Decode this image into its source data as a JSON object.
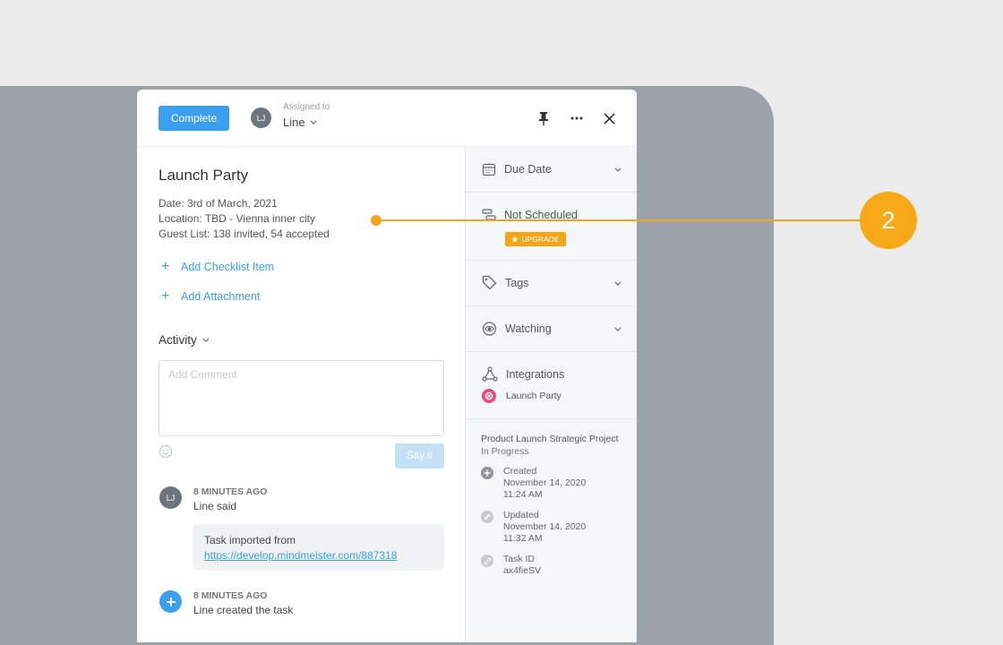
{
  "header": {
    "complete_label": "Complete",
    "avatar_initials": "LJ",
    "assigned_label": "Assigned to",
    "assignee_name": "Line"
  },
  "task": {
    "title": "Launch Party",
    "description": [
      "Date: 3rd of March, 2021",
      "Location: TBD - Vienna inner city",
      "Guest List: 138 invited, 54 accepted"
    ],
    "add_checklist_label": "Add Checklist Item",
    "add_attachment_label": "Add Attachment"
  },
  "activity": {
    "label": "Activity",
    "comment_placeholder": "Add Comment",
    "say_it_label": "Say it",
    "feed": [
      {
        "avatar": "LJ",
        "time": "8 MINUTES AGO",
        "text": "Line said",
        "bubble_text": "Task imported from",
        "bubble_link": "https://develop.mindmeister.com/887318"
      },
      {
        "time": "8 MINUTES AGO",
        "text": "Line created the task"
      }
    ]
  },
  "sidebar": {
    "due_date": "Due Date",
    "not_scheduled": "Not Scheduled",
    "upgrade": "UPGRADE",
    "tags": "Tags",
    "watching": "Watching",
    "integrations": "Integrations",
    "integration_item": "Launch Party",
    "project_name": "Product Launch Strategic Project",
    "project_status": "In Progress",
    "created_label": "Created",
    "created_date": "November 14, 2020",
    "created_time": "11:24 AM",
    "updated_label": "Updated",
    "updated_date": "November 14, 2020",
    "updated_time": "11:32 AM",
    "task_id_label": "Task ID",
    "task_id": "ax4fieSV"
  },
  "callout": {
    "number": "2"
  },
  "colors": {
    "accent_blue": "#3aa0ee",
    "callout_orange": "#f2a51a",
    "backdrop": "#9aa1a8"
  }
}
